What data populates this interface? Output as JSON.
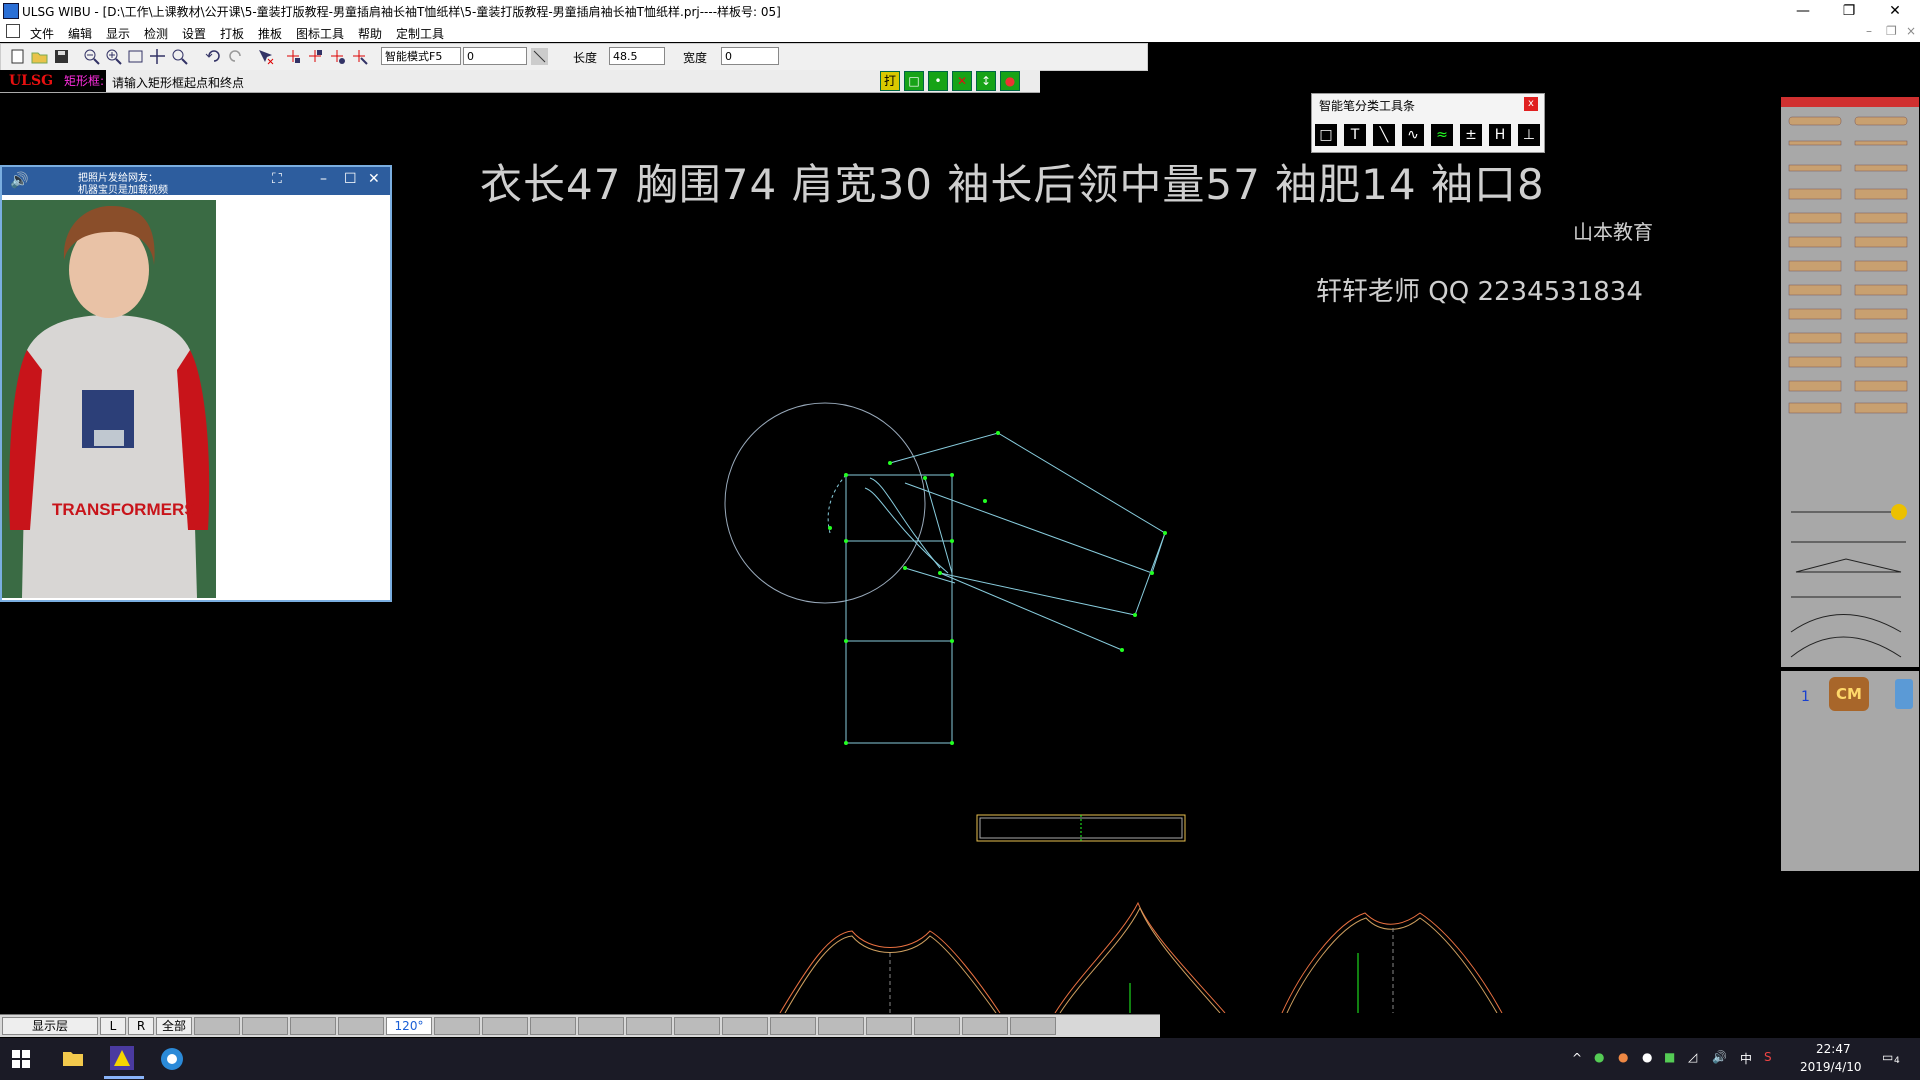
{
  "window": {
    "title": "ULSG WIBU - [D:\\工作\\上课教材\\公开课\\5-童装打版教程-男童插肩袖长袖T恤纸样\\5-童装打版教程-男童插肩袖长袖T恤纸样.prj----样板号: 05]",
    "controls": [
      "—",
      "❐",
      "✕"
    ]
  },
  "menu": [
    "文件",
    "编辑",
    "显示",
    "检测",
    "设置",
    "打板",
    "推板",
    "图标工具",
    "帮助",
    "定制工具"
  ],
  "toolbar": {
    "mode_select": "智能模式F5",
    "field_a": "0",
    "length_label": "长度",
    "length_value": "48.5",
    "width_label": "宽度",
    "width_value": "0"
  },
  "status": {
    "brand": "ULSG",
    "mode": "矩形框:",
    "prompt": "请输入矩形框起点和终点",
    "green_buttons": [
      "打",
      "□",
      "•",
      "✕",
      "↕",
      "●"
    ]
  },
  "overlay": {
    "measurements": "衣长47  胸围74  肩宽30  袖长后领中量57  袖肥14  袖口8",
    "brand": "山本教育",
    "teacher": "轩轩老师   QQ   2234531834"
  },
  "smart_toolbar": {
    "title": "智能笔分类工具条",
    "close": "x",
    "tools": [
      "□",
      "T",
      "╲",
      "∿",
      "≈",
      "±",
      "H",
      "⊥"
    ]
  },
  "video": {
    "title": "把照片发给网友：",
    "subtitle": "机器宝贝是加载视频",
    "shirt_text": "TRANSFORMERS"
  },
  "rightpanel": {
    "page_num": "1",
    "cm_label": "CM"
  },
  "layerbar": {
    "show_layer": "显示层",
    "l": "L",
    "r": "R",
    "all": "全部",
    "angle": "120°"
  },
  "tray": {
    "time": "22:47",
    "date": "2019/4/10",
    "ime": "中",
    "notify": "4"
  }
}
